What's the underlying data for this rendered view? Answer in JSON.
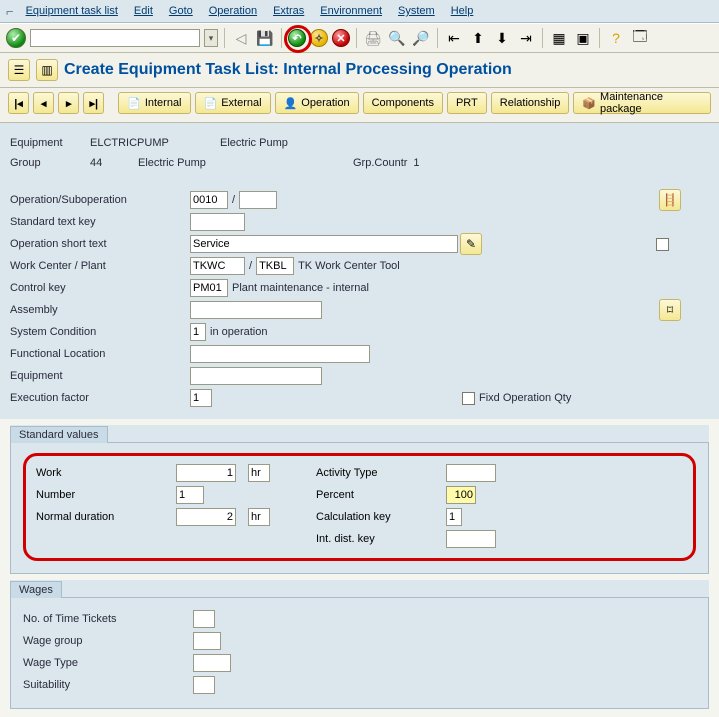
{
  "menu": {
    "items": [
      "Equipment task list",
      "Edit",
      "Goto",
      "Operation",
      "Extras",
      "Environment",
      "System",
      "Help"
    ]
  },
  "title": "Create Equipment Task List: Internal Processing Operation",
  "tabs": {
    "internal": "Internal",
    "external": "External",
    "operation": "Operation",
    "components": "Components",
    "prt": "PRT",
    "relationship": "Relationship",
    "maintpkg": "Maintenance package"
  },
  "info": {
    "equip_label": "Equipment",
    "equip_val": "ELCTRICPUMP",
    "equip_desc": "Electric Pump",
    "group_label": "Group",
    "group_val": "44",
    "group_desc": "Electric Pump",
    "grpcnt_label": "Grp.Countr",
    "grpcnt_val": "1"
  },
  "form": {
    "op_label": "Operation/Suboperation",
    "op_val": "0010",
    "op_sep": "/",
    "stdkey_label": "Standard text key",
    "short_label": "Operation short text",
    "short_val": "Service",
    "wc_label": "Work Center / Plant",
    "wc_val": "TKWC",
    "wc_sep": "/",
    "plant_val": "TKBL",
    "wc_after": "TK Work Center Tool",
    "ctrl_label": "Control key",
    "ctrl_val": "PM01",
    "ctrl_after": "Plant maintenance - internal",
    "asm_label": "Assembly",
    "sys_label": "System Condition",
    "sys_val": "1",
    "sys_after": "in operation",
    "floc_label": "Functional Location",
    "equip_label": "Equipment",
    "exec_label": "Execution factor",
    "exec_val": "1",
    "fixop_label": "Fixd Operation Qty"
  },
  "std": {
    "title": "Standard values",
    "work_label": "Work",
    "work_val": "1",
    "work_unit": "hr",
    "act_label": "Activity Type",
    "num_label": "Number",
    "num_val": "1",
    "pct_label": "Percent",
    "pct_val": "100",
    "dur_label": "Normal duration",
    "dur_val": "2",
    "dur_unit": "hr",
    "calc_label": "Calculation key",
    "calc_val": "1",
    "dist_label": "Int. dist. key"
  },
  "wages": {
    "title": "Wages",
    "tickets_label": "No. of Time Tickets",
    "group_label": "Wage group",
    "type_label": "Wage Type",
    "suit_label": "Suitability"
  }
}
